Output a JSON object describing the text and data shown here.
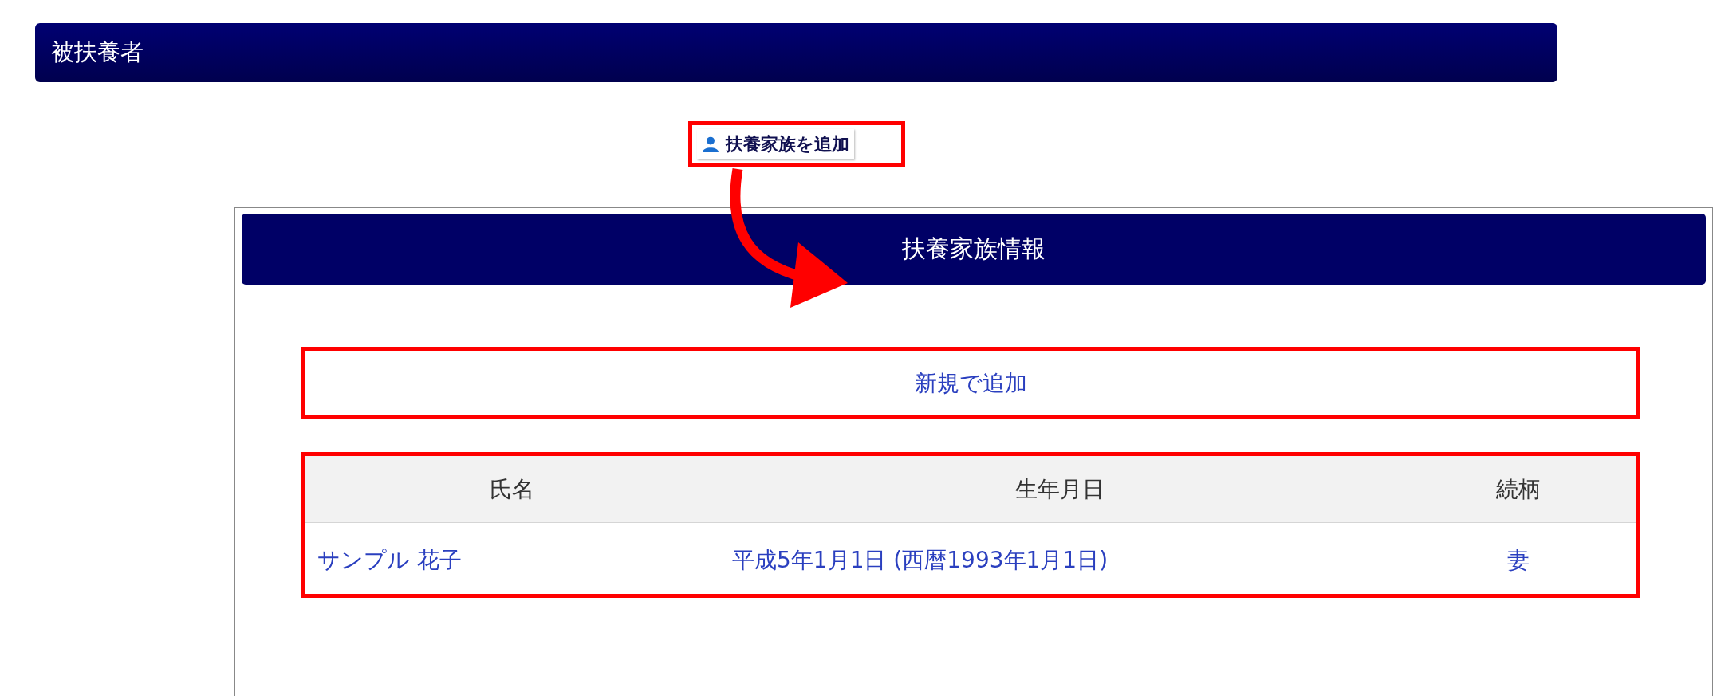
{
  "section": {
    "title": "被扶養者"
  },
  "add_button": {
    "label": "扶養家族を追加"
  },
  "dialog": {
    "title": "扶養家族情報",
    "new_button": {
      "label": "新規で追加"
    },
    "table": {
      "columns": [
        "氏名",
        "生年月日",
        "続柄"
      ],
      "rows": [
        [
          "サンプル 花子",
          "平成5年1月1日 (西暦1993年1月1日)",
          "妻"
        ]
      ]
    }
  }
}
